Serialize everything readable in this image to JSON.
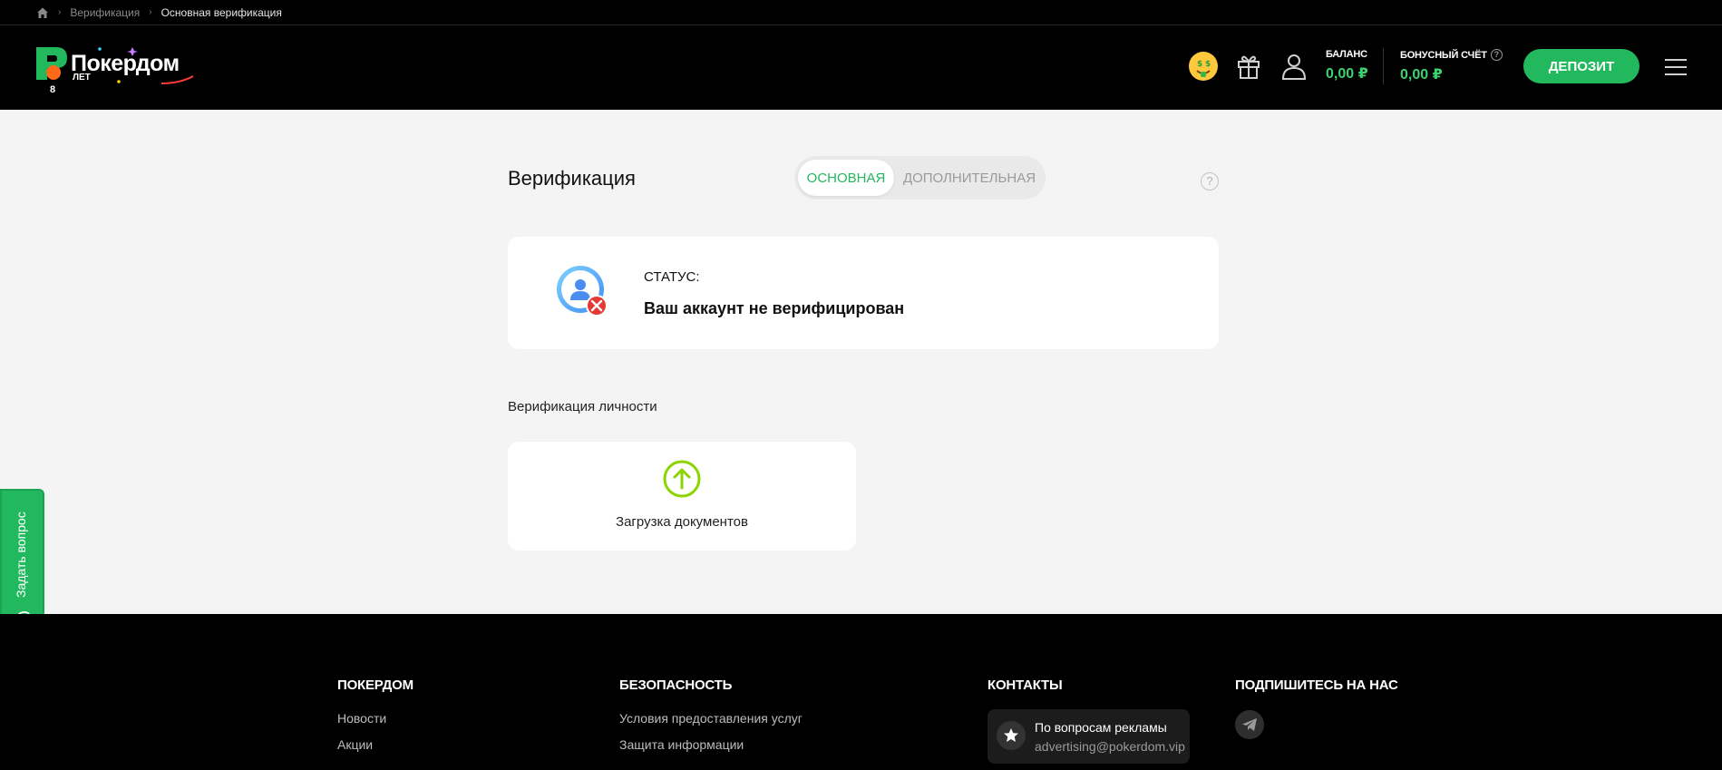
{
  "breadcrumb": {
    "items": [
      "Верификация",
      "Основная верификация"
    ]
  },
  "header": {
    "logo_text": "Покердом",
    "logo_years_number": "8",
    "logo_years_label": "ЛЕТ",
    "balance_label": "БАЛАНС",
    "balance_value": "0,00 ₽",
    "bonus_label": "БОНУСНЫЙ СЧЁТ",
    "bonus_value": "0,00 ₽",
    "bonus_help": "?",
    "deposit_label": "ДЕПОЗИТ"
  },
  "page": {
    "title": "Верификация",
    "tabs": [
      {
        "label": "ОСНОВНАЯ",
        "active": true
      },
      {
        "label": "ДОПОЛНИТЕЛЬНАЯ",
        "active": false
      }
    ],
    "help": "?"
  },
  "status": {
    "label": "СТАТУС:",
    "value": "Ваш аккаунт не верифицирован"
  },
  "identity": {
    "section_label": "Верификация личности",
    "upload_label": "Загрузка документов"
  },
  "ask_button": {
    "label": "Задать вопрос"
  },
  "footer": {
    "columns": [
      {
        "title": "ПОКЕРДОМ",
        "links": [
          "Новости",
          "Акции"
        ]
      },
      {
        "title": "БЕЗОПАСНОСТЬ",
        "links": [
          "Условия предоставления услуг",
          "Защита информации"
        ]
      },
      {
        "title": "КОНТАКТЫ"
      },
      {
        "title": "ПОДПИШИТЕСЬ НА НАС"
      }
    ],
    "ad_title": "По вопросам рекламы",
    "ad_email": "advertising@pokerdom.vip"
  },
  "colors": {
    "accent_green": "#22b85e",
    "balance_green": "#3bd16f",
    "error_red": "#e53935",
    "upload_green": "#8bd500"
  }
}
